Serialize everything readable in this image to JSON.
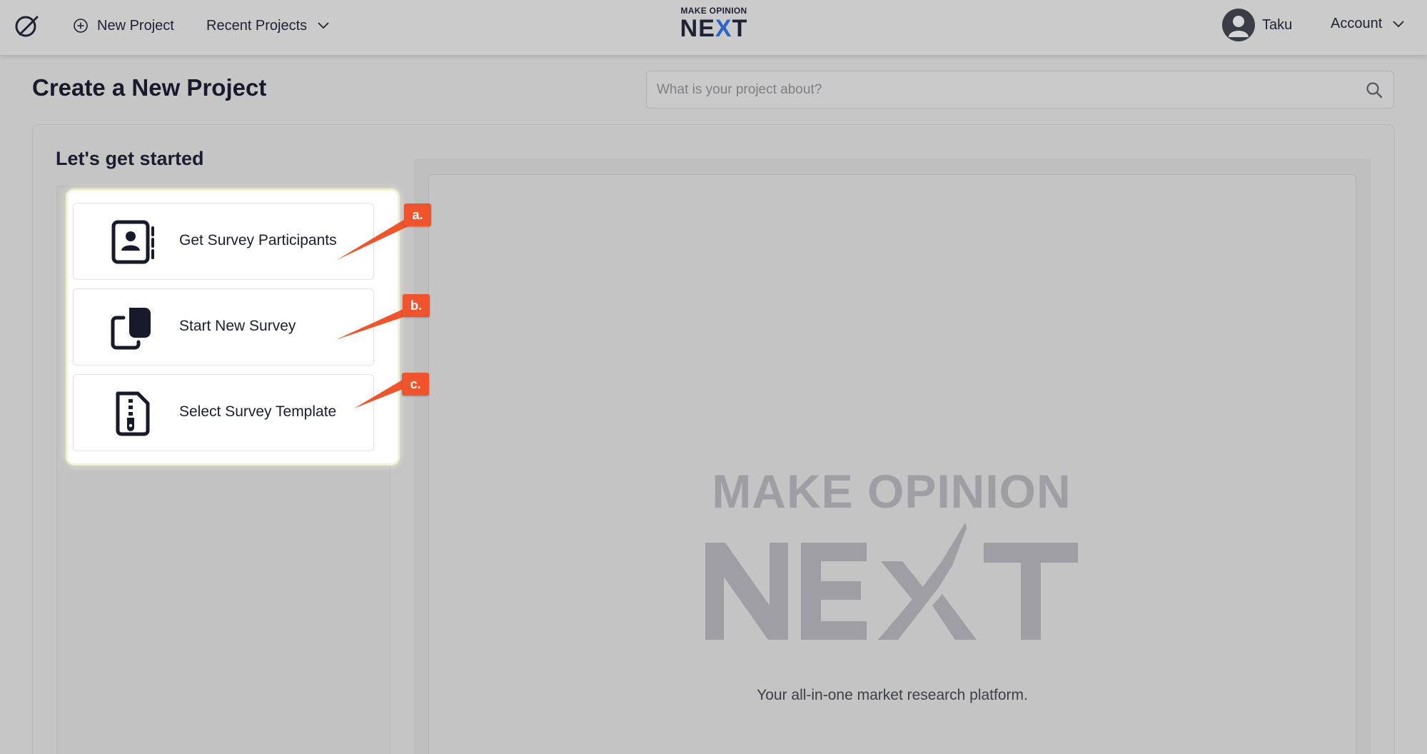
{
  "topbar": {
    "new_project": "New Project",
    "recent_projects": "Recent Projects",
    "brand_small": "MAKE OPINION",
    "brand_big_left": "NE",
    "brand_big_x": "X",
    "brand_big_right": "T",
    "user_name": "Taku",
    "account": "Account"
  },
  "header": {
    "title": "Create a New Project",
    "search_placeholder": "What is your project about?"
  },
  "panel": {
    "heading": "Let's get started"
  },
  "options": [
    {
      "label": "Get Survey Participants",
      "icon": "contact-book-icon",
      "tag": "a."
    },
    {
      "label": "Start New Survey",
      "icon": "copy-document-icon",
      "tag": "b."
    },
    {
      "label": "Select Survey Template",
      "icon": "zip-file-icon",
      "tag": "c."
    }
  ],
  "watermark": {
    "line1": "MAKE OPINION",
    "line2": "NEXT",
    "tagline": "Your all-in-one market research platform."
  },
  "colors": {
    "accent_tag": "#f0542c",
    "brand_blue": "#2c64c8",
    "text_dark": "#1e2233"
  }
}
